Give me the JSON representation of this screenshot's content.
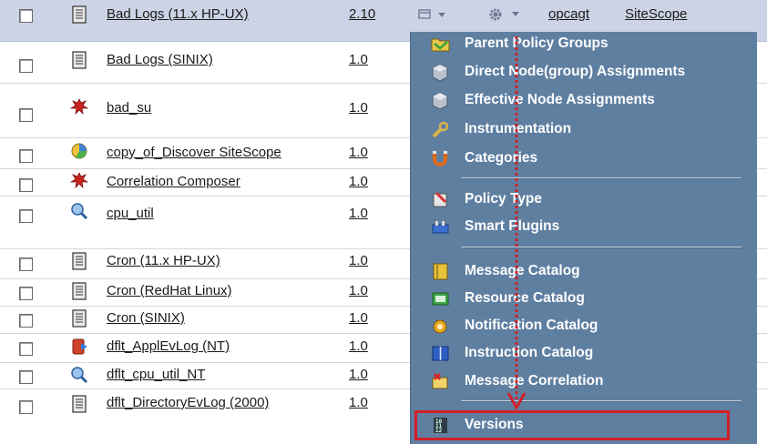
{
  "colors": {
    "menu_bg": "#5f7fa1",
    "selected_row_bg": "#ccd3e6",
    "highlight": "#d31f27"
  },
  "rows": [
    {
      "name": "Bad Logs (11.x HP-UX)",
      "version": "2.10",
      "icon": "document-icon"
    },
    {
      "name": "Bad Logs (SINIX)",
      "version": "1.0",
      "icon": "document-icon"
    },
    {
      "name": "bad_su",
      "version": "1.0",
      "icon": "event-policy-icon"
    },
    {
      "name": "copy_of_Discover SiteScope",
      "version": "1.0",
      "icon": "discovery-policy-icon"
    },
    {
      "name": "Correlation Composer",
      "version": "1.0",
      "icon": "event-policy-icon"
    },
    {
      "name": "cpu_util",
      "version": "1.0",
      "icon": "monitor-policy-icon"
    },
    {
      "name": "Cron (11.x HP-UX)",
      "version": "1.0",
      "icon": "document-icon"
    },
    {
      "name": "Cron (RedHat Linux)",
      "version": "1.0",
      "icon": "document-icon"
    },
    {
      "name": "Cron (SINIX)",
      "version": "1.0",
      "icon": "document-icon"
    },
    {
      "name": "dflt_ApplEvLog (NT)",
      "version": "1.0",
      "icon": "windows-log-policy-icon"
    },
    {
      "name": "dflt_cpu_util_NT",
      "version": "1.0",
      "icon": "monitor-policy-icon"
    },
    {
      "name": "dflt_DirectoryEvLog (2000)",
      "version": "1.0",
      "icon": "document-icon"
    }
  ],
  "row_tools": {
    "owner_link": "opcagt",
    "type_link": "SiteScope"
  },
  "menu": {
    "items": [
      {
        "label": "Parent Policy Groups",
        "icon": "folder-group-icon"
      },
      {
        "label": "Direct Node(group) Assignments",
        "icon": "node-cube-icon"
      },
      {
        "label": "Effective Node Assignments",
        "icon": "node-cube-icon"
      },
      {
        "label": "Instrumentation",
        "icon": "wrench-icon"
      },
      {
        "label": "Categories",
        "icon": "magnet-icon"
      },
      {
        "label": "Policy Type",
        "icon": "policy-type-icon"
      },
      {
        "label": "Smart Plugins",
        "icon": "smart-plugin-icon"
      },
      {
        "label": "Message Catalog",
        "icon": "message-catalog-icon"
      },
      {
        "label": "Resource Catalog",
        "icon": "resource-catalog-icon"
      },
      {
        "label": "Notification Catalog",
        "icon": "notification-icon"
      },
      {
        "label": "Instruction Catalog",
        "icon": "instruction-book-icon"
      },
      {
        "label": "Message Correlation",
        "icon": "correlation-icon"
      },
      {
        "label": "Versions",
        "icon": "versions-icon"
      }
    ]
  }
}
